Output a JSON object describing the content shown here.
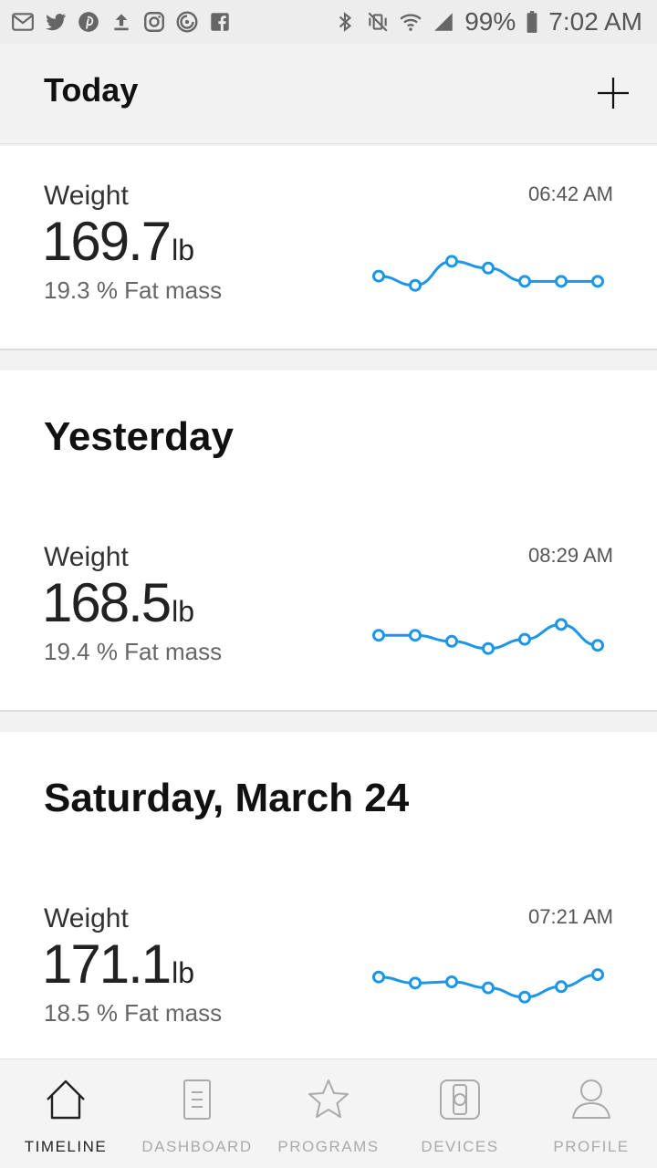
{
  "status_bar": {
    "left_icons": [
      "gmail-icon",
      "twitter-icon",
      "pinterest-icon",
      "upload-icon",
      "instagram-icon",
      "sync-icon",
      "facebook-icon"
    ],
    "right_icons": [
      "bluetooth-icon",
      "vibrate-mute-icon",
      "wifi-icon",
      "signal-icon",
      "battery-icon"
    ],
    "battery": "99%",
    "time": "7:02 AM"
  },
  "header": {
    "title": "Today",
    "add_icon": "plus-icon"
  },
  "accent_color": "#1e96e8",
  "sections": [
    {
      "title": "",
      "entry": {
        "label": "Weight",
        "value": "169.7",
        "unit": "lb",
        "fat": "19.3 % Fat mass",
        "time": "06:42 AM",
        "trend": [
          0.35,
          0.12,
          0.72,
          0.55,
          0.22,
          0.22,
          0.22
        ]
      }
    },
    {
      "title": "Yesterday",
      "entry": {
        "label": "Weight",
        "value": "168.5",
        "unit": "lb",
        "fat": "19.4 % Fat mass",
        "time": "08:29 AM",
        "trend": [
          0.45,
          0.45,
          0.3,
          0.12,
          0.35,
          0.72,
          0.2
        ]
      }
    },
    {
      "title": "Saturday, March 24",
      "entry": {
        "label": "Weight",
        "value": "171.1",
        "unit": "lb",
        "fat": "18.5 % Fat mass",
        "time": "07:21 AM",
        "trend": [
          0.62,
          0.47,
          0.5,
          0.35,
          0.12,
          0.38,
          0.68
        ]
      }
    }
  ],
  "nav": [
    {
      "label": "TIMELINE",
      "icon": "home-icon",
      "active": true
    },
    {
      "label": "DASHBOARD",
      "icon": "dashboard-icon",
      "active": false
    },
    {
      "label": "PROGRAMS",
      "icon": "star-icon",
      "active": false
    },
    {
      "label": "DEVICES",
      "icon": "watch-icon",
      "active": false
    },
    {
      "label": "PROFILE",
      "icon": "person-icon",
      "active": false
    }
  ]
}
